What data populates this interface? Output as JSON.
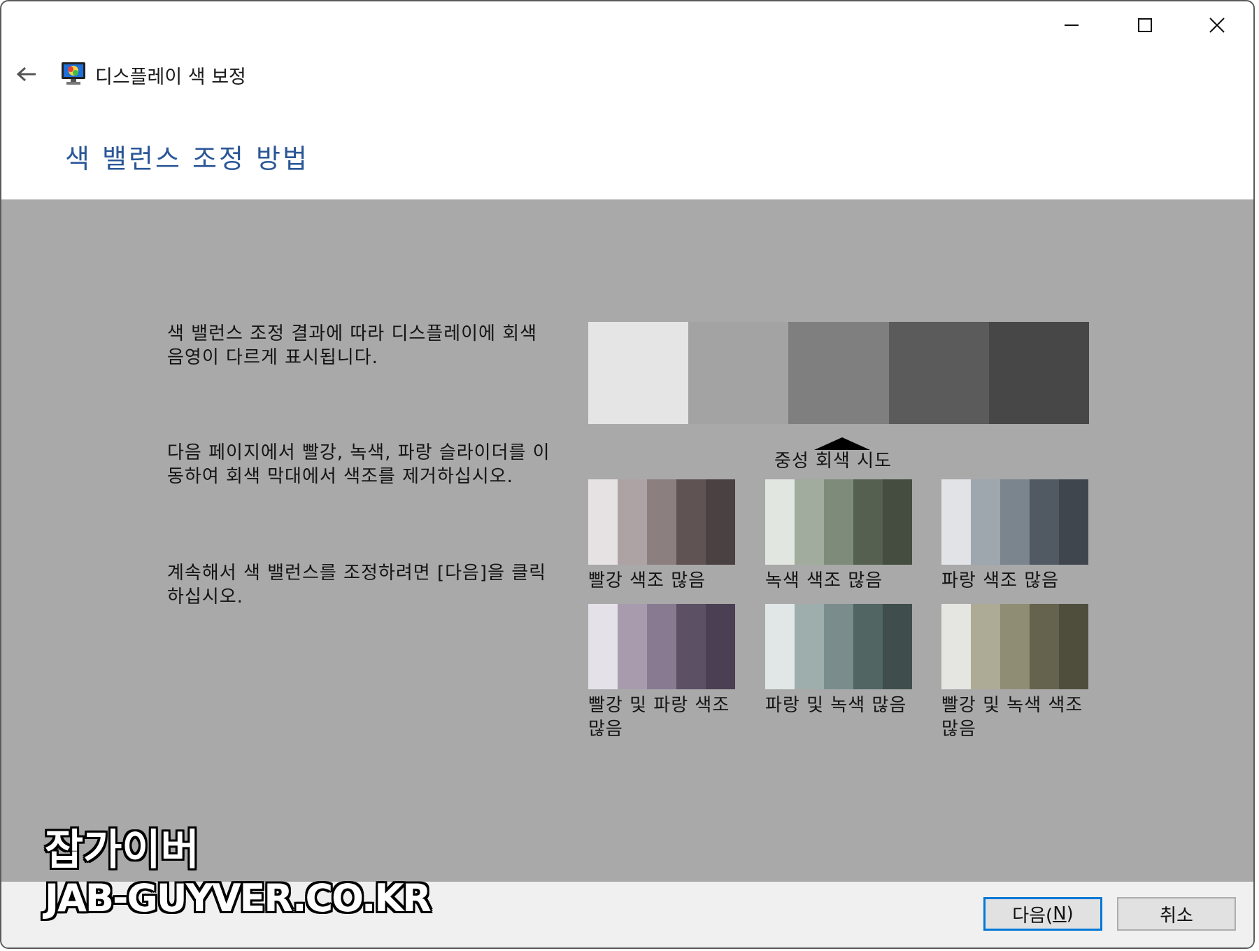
{
  "window": {
    "minimize_icon": "minimize-icon",
    "maximize_icon": "maximize-icon",
    "close_icon": "close-icon"
  },
  "nav": {
    "back_icon": "back-arrow-icon",
    "app_icon": "display-monitor-icon",
    "title": "디스플레이 색 보정"
  },
  "heading": "색 밸런스 조정 방법",
  "paragraphs": {
    "p1": "색 밸런스 조정 결과에 따라 디스플레이에 회색 음영이 다르게 표시됩니다.",
    "p2": "다음 페이지에서 빨강, 녹색, 파랑 슬라이더를 이동하여 회색 막대에서 색조를 제거하십시오.",
    "p3": "계속해서 색 밸런스를 조정하려면 [다음]을 클릭하십시오."
  },
  "gray_bar": {
    "colors": [
      "#e5e5e5",
      "#a3a3a3",
      "#7f7f7f",
      "#5b5b5b",
      "#474747"
    ]
  },
  "neutral_label": "중성 회색 시도",
  "swatches": [
    {
      "caption": "빨강 색조 많음",
      "colors": [
        "#e6e2e3",
        "#aea3a4",
        "#8c7f80",
        "#5f5354",
        "#4a4142"
      ]
    },
    {
      "caption": "녹색 색조 많음",
      "colors": [
        "#e1e6e0",
        "#a1ac9e",
        "#7e8b7a",
        "#556050",
        "#444d40"
      ]
    },
    {
      "caption": "파랑 색조 많음",
      "colors": [
        "#e1e3e7",
        "#9ea6ae",
        "#7b858e",
        "#515962",
        "#3f464d"
      ]
    },
    {
      "caption": "빨강 및 파랑 색조 많음",
      "colors": [
        "#e4e1e8",
        "#a79bad",
        "#877a91",
        "#5c5065",
        "#4a3f53"
      ]
    },
    {
      "caption": "파랑 및 녹색 많음",
      "colors": [
        "#e1e6e6",
        "#9eaeac",
        "#7a8d8c",
        "#516563",
        "#3f4e4c"
      ]
    },
    {
      "caption": "빨강 및 녹색 색조 많음",
      "colors": [
        "#e5e6e1",
        "#adab95",
        "#8f8d74",
        "#65634d",
        "#4f4d3c"
      ]
    }
  ],
  "buttons": {
    "next_label": "다음(",
    "next_mnemonic": "N",
    "next_close": ")",
    "cancel_label": "취소"
  },
  "watermark": {
    "line1": "잡가이버",
    "line2": "JAB-GUYVER.CO.KR"
  }
}
